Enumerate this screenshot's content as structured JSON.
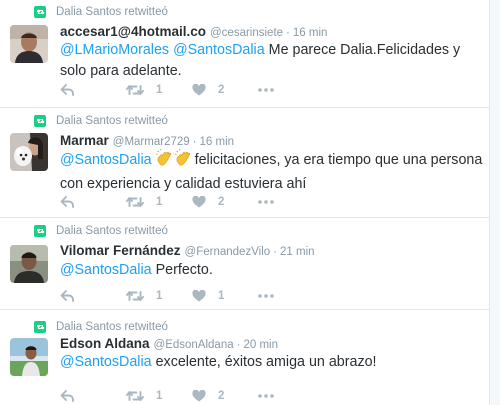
{
  "tweets": [
    {
      "retweet_context": "Dalia Santos retwitteó",
      "fullname": "accesar1@4hotmail.co",
      "username": "@cesarinsiete",
      "separator": "·",
      "time": "16 min",
      "mentions": [
        "@LMarioMorales",
        "@SantosDalia"
      ],
      "text": "Me parece Dalia.Felicidades y solo para adelante.",
      "retweet_count": "1",
      "like_count": "2",
      "avatar_icon": "person-photo"
    },
    {
      "retweet_context": "Dalia Santos retwitteó",
      "fullname": "Marmar",
      "username": "@Marmar2729",
      "separator": "·",
      "time": "16 min",
      "mention": "@SantosDalia",
      "text_after_emoji": "felicitaciones, ya era tiempo que una persona con experiencia y calidad estuviera ahí",
      "emoji": "clapping-hands-icon",
      "retweet_count": "1",
      "like_count": "2",
      "avatar_icon": "person-with-dog-photo"
    },
    {
      "retweet_context": "Dalia Santos retwitteó",
      "fullname": "Vilomar Fernández",
      "username": "@FernandezVilo",
      "separator": "·",
      "time": "21 min",
      "mention": "@SantosDalia",
      "text": "Perfecto.",
      "retweet_count": "1",
      "like_count": "1",
      "avatar_icon": "person-photo"
    },
    {
      "retweet_context": "Dalia Santos retwitteó",
      "fullname": "Edson Aldana",
      "username": "@EdsonAldana",
      "separator": "·",
      "time": "20 min",
      "mention": "@SantosDalia",
      "text": "excelente, éxitos amiga un abrazo!",
      "retweet_count": "1",
      "like_count": "2",
      "avatar_icon": "person-outdoors-photo"
    }
  ],
  "colors": {
    "link": "#1da1f2",
    "retweet_green": "#19cf86",
    "meta_gray": "#8899a6",
    "action_gray": "#aab8c2",
    "text": "#292f33",
    "divider": "#e1e8ed"
  }
}
